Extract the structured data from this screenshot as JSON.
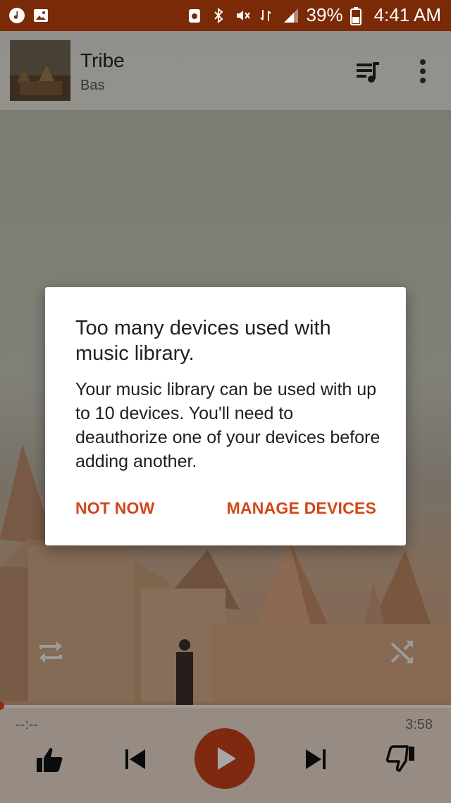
{
  "status_bar": {
    "battery": "39%",
    "time": "4:41 AM",
    "left_icons": [
      "music-note-icon",
      "image-icon"
    ],
    "right_icons": [
      "recycle-icon",
      "bluetooth-icon",
      "mute-icon",
      "data-icon",
      "signal-icon",
      "battery-icon"
    ]
  },
  "now_playing": {
    "title": "Tribe",
    "artist": "Bas"
  },
  "dialog": {
    "title": "Too many devices used with music library.",
    "message": "Your music library can be used with up to 10 devices. You'll need to deauthorize one of your devices before adding another.",
    "negative_button": "NOT NOW",
    "positive_button": "MANAGE DEVICES"
  },
  "player": {
    "elapsed": "--:--",
    "duration": "3:58",
    "progress": 0
  },
  "colors": {
    "status_bar": "#7a2a06",
    "accent": "#d1471a",
    "play_button": "#c4411a"
  },
  "icons": [
    "queue-music-icon",
    "more-vert-icon",
    "repeat-icon",
    "shuffle-icon",
    "thumb-up-icon",
    "skip-previous-icon",
    "play-icon",
    "skip-next-icon",
    "thumb-down-icon"
  ]
}
